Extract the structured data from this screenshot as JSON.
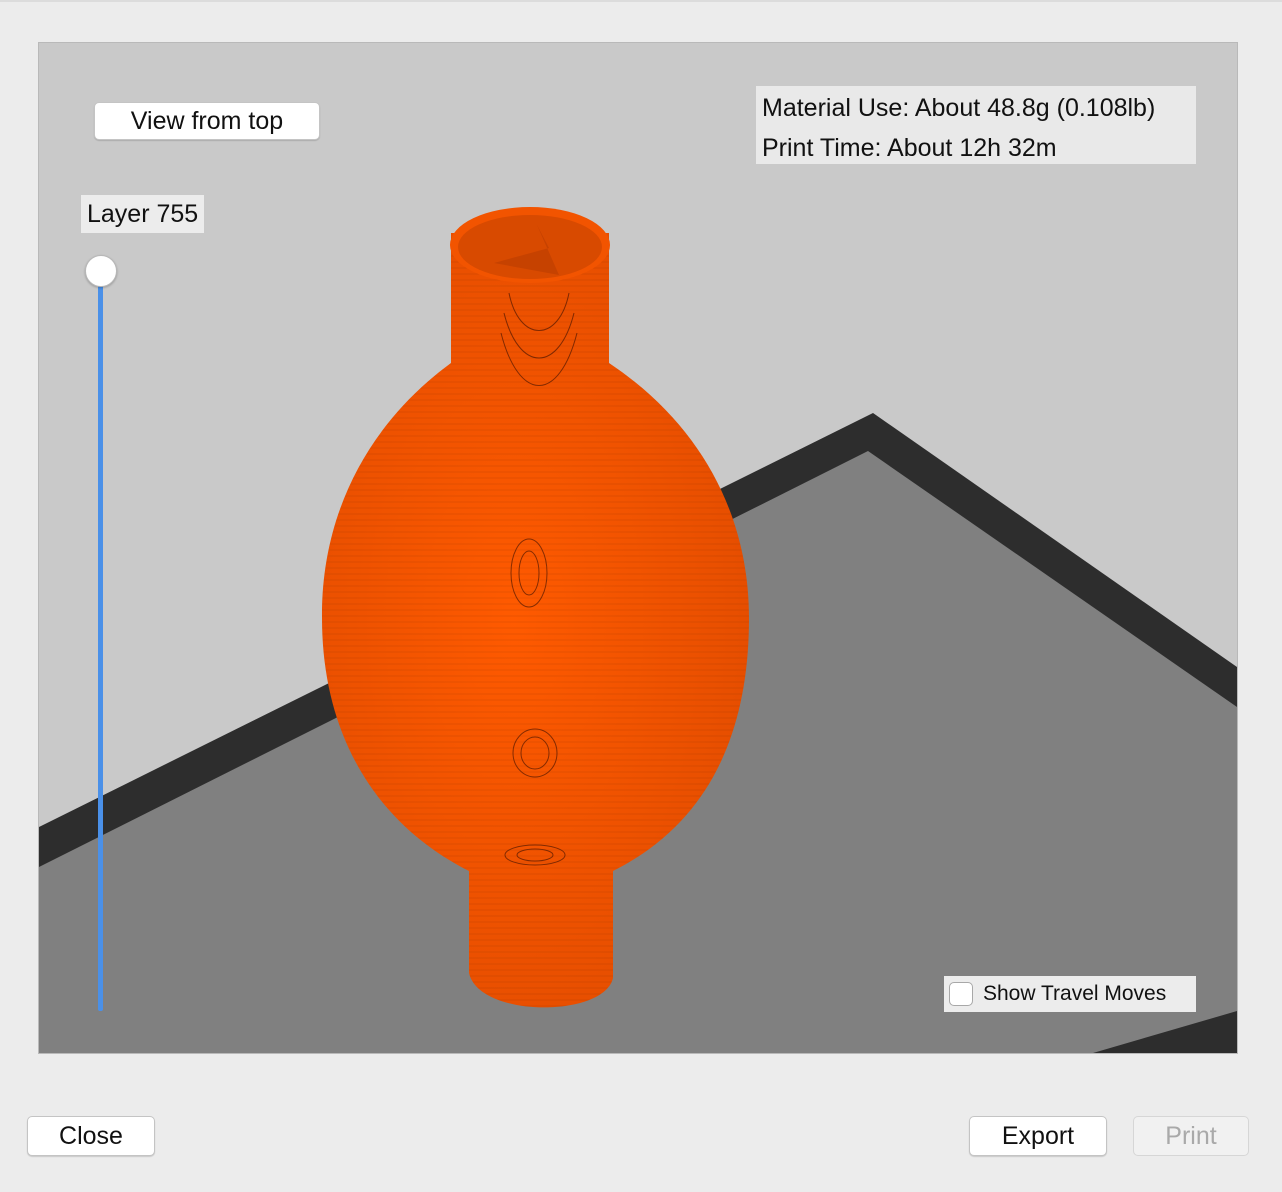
{
  "viewport": {
    "view_from_top_label": "View from top",
    "layer_label": "Layer 755",
    "layer_slider_value": 755,
    "material_use": "Material Use: About 48.8g (0.108lb)",
    "print_time": "Print Time: About 12h 32m",
    "show_travel_moves_label": "Show Travel Moves",
    "show_travel_moves_checked": false
  },
  "footer": {
    "close_label": "Close",
    "export_label": "Export",
    "print_label": "Print"
  },
  "colors": {
    "model": "#f25400",
    "bed": "#808080",
    "bed_border": "#2d2d2d",
    "background": "#c9c9c9",
    "slider": "#4a90e8"
  }
}
